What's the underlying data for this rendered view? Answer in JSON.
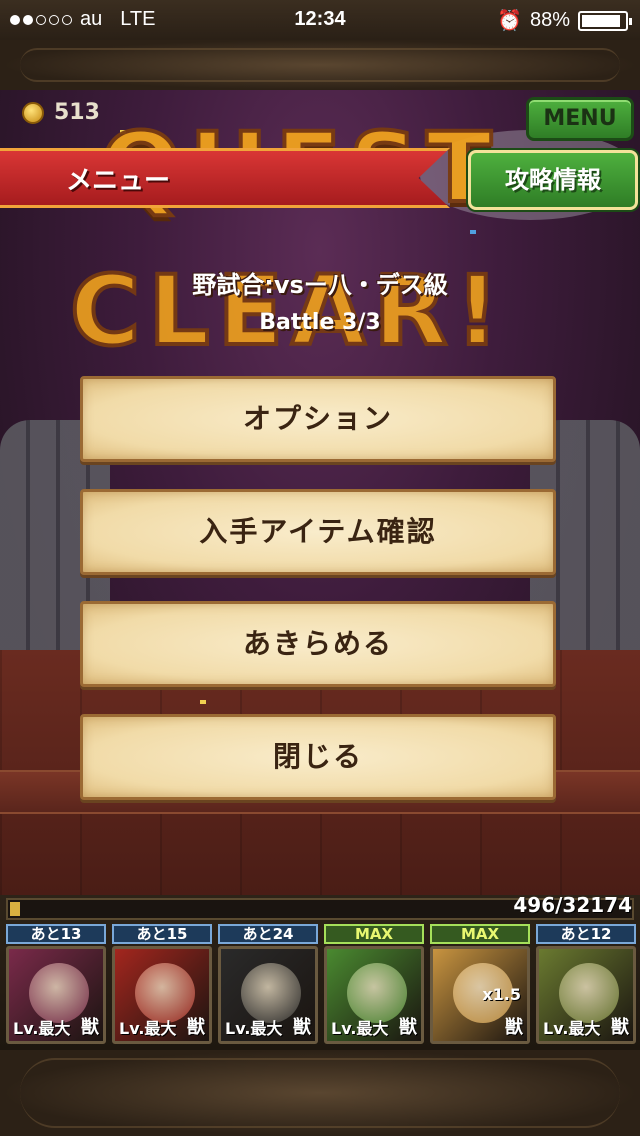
{
  "status_bar": {
    "carrier": "au",
    "network": "LTE",
    "time": "12:34",
    "battery": "88%",
    "signal_dots_filled": 2,
    "signal_dots_total": 5
  },
  "header": {
    "coins": "513",
    "menu_button": "MENU"
  },
  "menu_banner": "メニュー",
  "strategy_button": "攻略情報",
  "background_text": {
    "line1": "QUEST",
    "line2": "CLEAR!"
  },
  "quest": {
    "title": "野試合:vsー八・デス級",
    "battle": "Battle 3/3"
  },
  "menu_items": [
    {
      "label": "オプション"
    },
    {
      "label": "入手アイテム確認"
    },
    {
      "label": "あきらめる"
    },
    {
      "label": "閉じる"
    }
  ],
  "hp": {
    "current_text": "496/32174",
    "current": 496,
    "max": 32174
  },
  "team": [
    {
      "counter": "あと13",
      "level": "Lv.最大",
      "beast": "獣",
      "max": false,
      "color": "#7a2a4a"
    },
    {
      "counter": "あと15",
      "level": "Lv.最大",
      "beast": "獣",
      "max": false,
      "color": "#a3261e"
    },
    {
      "counter": "あと24",
      "level": "Lv.最大",
      "beast": "獣",
      "max": false,
      "color": "#2a2a2a"
    },
    {
      "counter": "MAX",
      "level": "Lv.最大",
      "beast": "獣",
      "max": true,
      "color": "#4a8a30"
    },
    {
      "counter": "MAX",
      "level": "",
      "beast": "獣",
      "max": true,
      "color": "#c89440",
      "multiplier": "x1.5"
    },
    {
      "counter": "あと12",
      "level": "Lv.最大",
      "beast": "獣",
      "max": false,
      "color": "#6a7a30"
    }
  ],
  "colors": {
    "accent_green": "#4eb03e",
    "banner_red": "#d93635",
    "parchment": "#f1dba8"
  }
}
